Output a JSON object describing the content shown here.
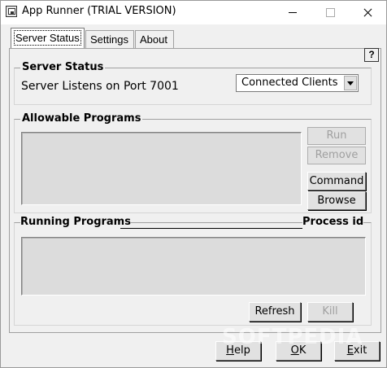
{
  "window": {
    "title": "App Runner (TRIAL VERSION)"
  },
  "tabs": [
    {
      "label": "Server Status",
      "active": true
    },
    {
      "label": "Settings",
      "active": false
    },
    {
      "label": "About",
      "active": false
    }
  ],
  "help_button": {
    "label": "?"
  },
  "server_status": {
    "group_title": "Server Status",
    "listen_text": "Server Listens on Port 7001",
    "view_select": {
      "value": "Connected Clients"
    }
  },
  "allowable_programs": {
    "group_title": "Allowable Programs",
    "buttons": {
      "run": "Run",
      "remove": "Remove",
      "command": "Command",
      "browse": "Browse"
    }
  },
  "running_programs": {
    "group_title": "Running Programs",
    "process_id_header": "Process id",
    "buttons": {
      "refresh": "Refresh",
      "kill": "Kill"
    }
  },
  "bottom_buttons": {
    "help_first": "H",
    "help_rest": "elp",
    "ok_first": "O",
    "ok_rest": "K",
    "exit_first": "E",
    "exit_rest": "xit"
  },
  "watermark": "SOFTPEDIA"
}
